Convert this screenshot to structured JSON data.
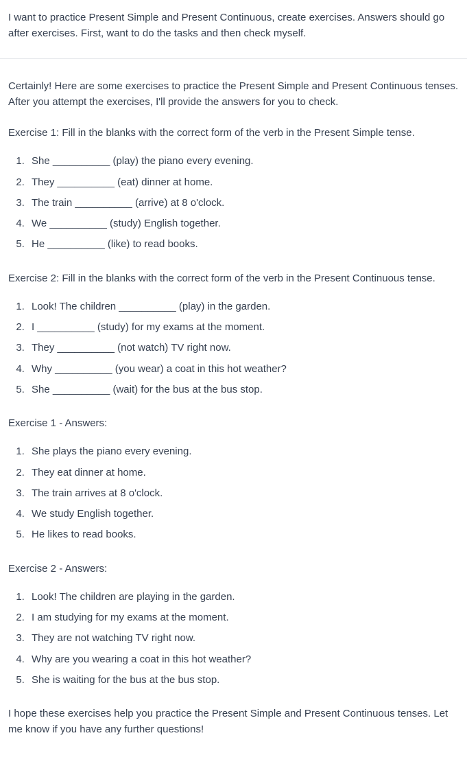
{
  "user": {
    "message": "I want to practice Present Simple and Present Continuous, create exercises. Answers should go after exercises. First, want to do the tasks and then check myself."
  },
  "assistant": {
    "intro": "Certainly! Here are some exercises to practice the Present Simple and Present Continuous tenses. After you attempt the exercises, I'll provide the answers for you to check.",
    "ex1_title": "Exercise 1: Fill in the blanks with the correct form of the verb in the Present Simple tense.",
    "ex1_items": [
      "She __________ (play) the piano every evening.",
      "They __________ (eat) dinner at home.",
      "The train __________ (arrive) at 8 o'clock.",
      "We __________ (study) English together.",
      "He __________ (like) to read books."
    ],
    "ex2_title": "Exercise 2: Fill in the blanks with the correct form of the verb in the Present Continuous tense.",
    "ex2_items": [
      "Look! The children __________ (play) in the garden.",
      "I __________ (study) for my exams at the moment.",
      "They __________ (not watch) TV right now.",
      "Why __________ (you wear) a coat in this hot weather?",
      "She __________ (wait) for the bus at the bus stop."
    ],
    "ans1_title": "Exercise 1 - Answers:",
    "ans1_items": [
      "She plays the piano every evening.",
      "They eat dinner at home.",
      "The train arrives at 8 o'clock.",
      "We study English together.",
      "He likes to read books."
    ],
    "ans2_title": "Exercise 2 - Answers:",
    "ans2_items": [
      "Look! The children are playing in the garden.",
      "I am studying for my exams at the moment.",
      "They are not watching TV right now.",
      "Why are you wearing a coat in this hot weather?",
      "She is waiting for the bus at the bus stop."
    ],
    "closing": "I hope these exercises help you practice the Present Simple and Present Continuous tenses. Let me know if you have any further questions!"
  }
}
